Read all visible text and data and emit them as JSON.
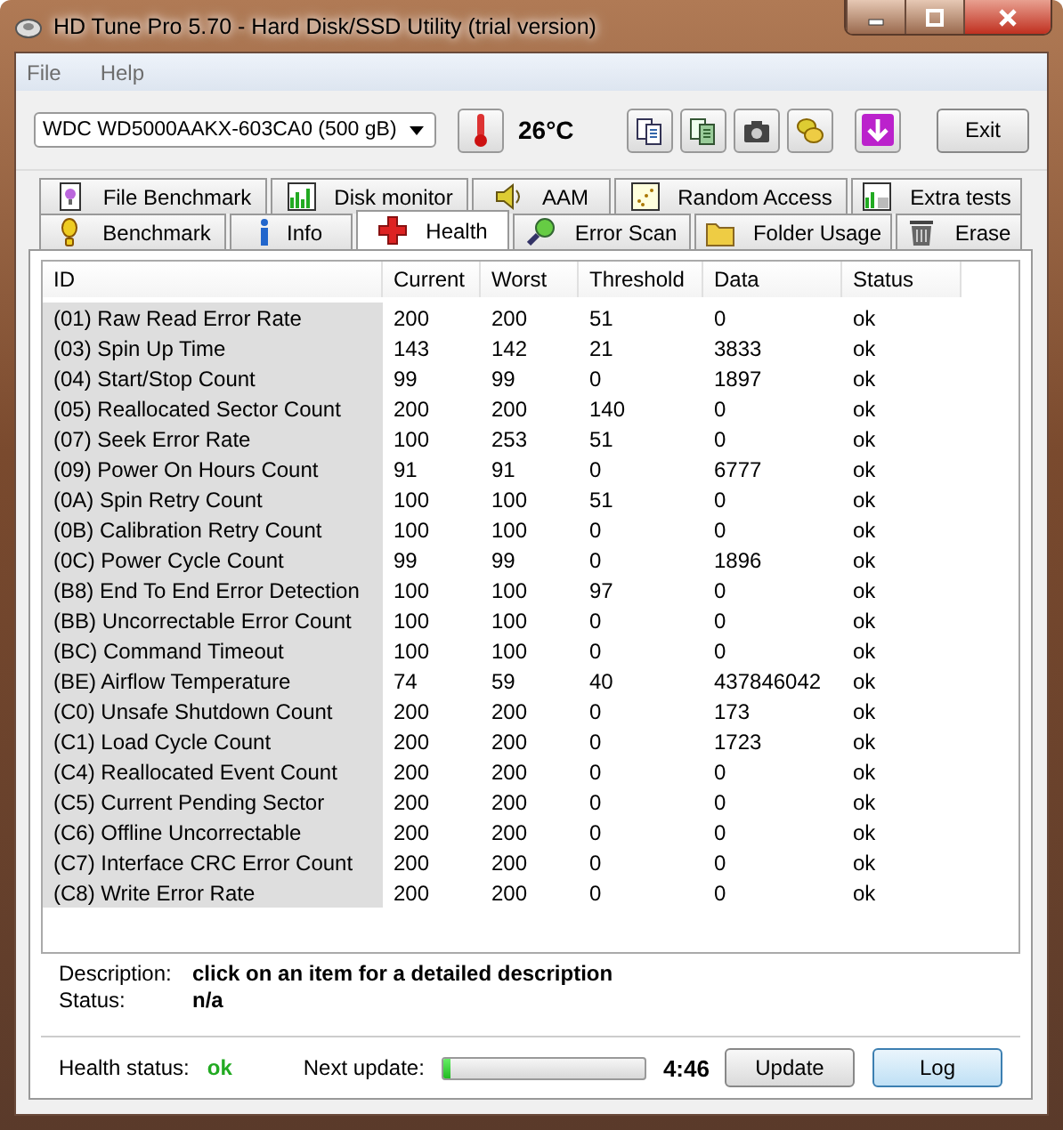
{
  "window": {
    "title": "HD Tune Pro 5.70 - Hard Disk/SSD Utility (trial version)"
  },
  "menu": [
    {
      "label": "File"
    },
    {
      "label": "Help"
    }
  ],
  "toolbar": {
    "drive": "WDC WD5000AAKX-603CA0 (500 gB)",
    "temperature": "26°C",
    "exit": "Exit"
  },
  "tabs": [
    [
      {
        "label": "File Benchmark",
        "selected": false
      },
      {
        "label": "Disk monitor",
        "selected": false
      },
      {
        "label": "AAM",
        "selected": false
      },
      {
        "label": "Random Access",
        "selected": false
      },
      {
        "label": "Extra tests",
        "selected": false
      }
    ],
    [
      {
        "label": "Benchmark",
        "selected": false
      },
      {
        "label": "Info",
        "selected": false
      },
      {
        "label": "Health",
        "selected": true
      },
      {
        "label": "Error Scan",
        "selected": false
      },
      {
        "label": "Folder Usage",
        "selected": false
      },
      {
        "label": "Erase",
        "selected": false
      }
    ]
  ],
  "table": {
    "columns": [
      "ID",
      "Current",
      "Worst",
      "Threshold",
      "Data",
      "Status"
    ],
    "rows": [
      [
        "(01) Raw Read Error Rate",
        "200",
        "200",
        "51",
        "0",
        "ok"
      ],
      [
        "(03) Spin Up Time",
        "143",
        "142",
        "21",
        "3833",
        "ok"
      ],
      [
        "(04) Start/Stop Count",
        "99",
        "99",
        "0",
        "1897",
        "ok"
      ],
      [
        "(05) Reallocated Sector Count",
        "200",
        "200",
        "140",
        "0",
        "ok"
      ],
      [
        "(07) Seek Error Rate",
        "100",
        "253",
        "51",
        "0",
        "ok"
      ],
      [
        "(09) Power On Hours Count",
        "91",
        "91",
        "0",
        "6777",
        "ok"
      ],
      [
        "(0A) Spin Retry Count",
        "100",
        "100",
        "51",
        "0",
        "ok"
      ],
      [
        "(0B) Calibration Retry Count",
        "100",
        "100",
        "0",
        "0",
        "ok"
      ],
      [
        "(0C) Power Cycle Count",
        "99",
        "99",
        "0",
        "1896",
        "ok"
      ],
      [
        "(B8) End To End Error Detection",
        "100",
        "100",
        "97",
        "0",
        "ok"
      ],
      [
        "(BB) Uncorrectable Error Count",
        "100",
        "100",
        "0",
        "0",
        "ok"
      ],
      [
        "(BC) Command Timeout",
        "100",
        "100",
        "0",
        "0",
        "ok"
      ],
      [
        "(BE) Airflow Temperature",
        "74",
        "59",
        "40",
        "437846042",
        "ok"
      ],
      [
        "(C0) Unsafe Shutdown Count",
        "200",
        "200",
        "0",
        "173",
        "ok"
      ],
      [
        "(C1) Load Cycle Count",
        "200",
        "200",
        "0",
        "1723",
        "ok"
      ],
      [
        "(C4) Reallocated Event Count",
        "200",
        "200",
        "0",
        "0",
        "ok"
      ],
      [
        "(C5) Current Pending Sector",
        "200",
        "200",
        "0",
        "0",
        "ok"
      ],
      [
        "(C6) Offline Uncorrectable",
        "200",
        "200",
        "0",
        "0",
        "ok"
      ],
      [
        "(C7) Interface CRC Error Count",
        "200",
        "200",
        "0",
        "0",
        "ok"
      ],
      [
        "(C8) Write Error Rate",
        "200",
        "200",
        "0",
        "0",
        "ok"
      ]
    ]
  },
  "details": [
    {
      "label": "Description:",
      "value": "click on an item for a detailed description"
    },
    {
      "label": "Status:",
      "value": "n/a"
    }
  ],
  "footer": {
    "health_label": "Health status:",
    "health_value": "ok",
    "next_label": "Next update:",
    "progress": {
      "level": 0.03
    },
    "time": "4:46",
    "buttons": [
      "Update",
      "Log"
    ]
  }
}
